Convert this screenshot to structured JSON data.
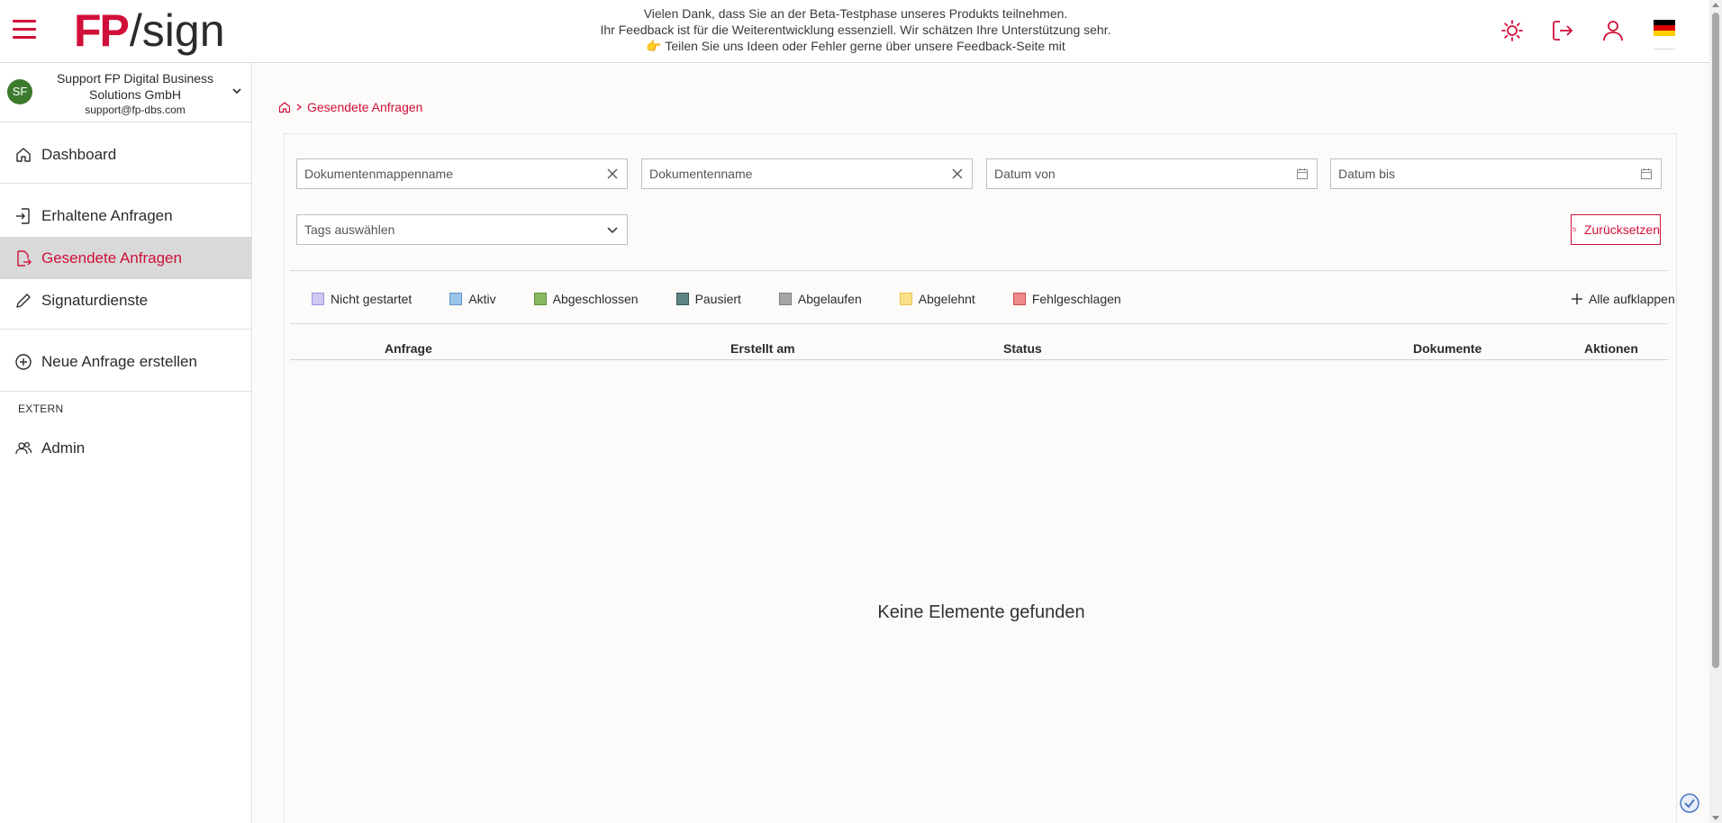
{
  "header": {
    "logo_brand": "FP",
    "logo_product": "/sign",
    "banner_line1": "Vielen Dank, dass Sie an der Beta-Testphase unseres Produkts teilnehmen.",
    "banner_line2": "Ihr Feedback ist für die Weiterentwicklung essenziell. Wir schätzen Ihre Unterstützung sehr.",
    "banner_line3": "👉 Teilen Sie uns Ideen oder Fehler gerne über unsere Feedback-Seite mit",
    "icons": [
      "menu-icon",
      "sun-icon",
      "logout-icon",
      "user-icon",
      "flag-de-icon"
    ]
  },
  "sidebar": {
    "org": {
      "initials": "SF",
      "name": "Support FP Digital Business Solutions GmbH",
      "email": "support@fp-dbs.com"
    },
    "items": [
      {
        "label": "Dashboard",
        "icon": "home-icon"
      },
      {
        "label": "Erhaltene Anfragen",
        "icon": "inbox-arrow-icon"
      },
      {
        "label": "Gesendete Anfragen",
        "icon": "sent-document-icon",
        "active": true
      },
      {
        "label": "Signaturdienste",
        "icon": "pen-icon"
      },
      {
        "label": "Neue Anfrage erstellen",
        "icon": "plus-circle-icon"
      },
      {
        "label": "Admin",
        "icon": "users-icon"
      }
    ],
    "section_extern": "EXTERN"
  },
  "breadcrumb": {
    "current": "Gesendete Anfragen"
  },
  "filters": {
    "folder_name": "Dokumentenmappenname",
    "document_name": "Dokumentenname",
    "date_from": "Datum von",
    "date_to": "Datum bis",
    "tags": "Tags auswählen",
    "reset_label": "Zurücksetzen"
  },
  "legend": [
    {
      "label": "Nicht gestartet",
      "fill": "#cfc8f3",
      "border": "#9f93dd"
    },
    {
      "label": "Aktiv",
      "fill": "#9cc3ea",
      "border": "#5f95c9"
    },
    {
      "label": "Abgeschlossen",
      "fill": "#8ab860",
      "border": "#5e8f3a"
    },
    {
      "label": "Pausiert",
      "fill": "#5f8585",
      "border": "#385959"
    },
    {
      "label": "Abgelaufen",
      "fill": "#a6a6a6",
      "border": "#7f7f7f"
    },
    {
      "label": "Abgelehnt",
      "fill": "#fbe08a",
      "border": "#e8c24a"
    },
    {
      "label": "Fehlgeschlagen",
      "fill": "#ee8a8a",
      "border": "#cc4d4d"
    }
  ],
  "expand_all_label": "Alle aufklappen",
  "table": {
    "columns": [
      "Anfrage",
      "Erstellt am",
      "Status",
      "Dokumente",
      "Aktionen"
    ],
    "empty_message": "Keine Elemente gefunden"
  },
  "colors": {
    "brand": "#d0103a",
    "active_nav_bg": "#d9d9d9",
    "avatar": "#3c7a2d"
  }
}
